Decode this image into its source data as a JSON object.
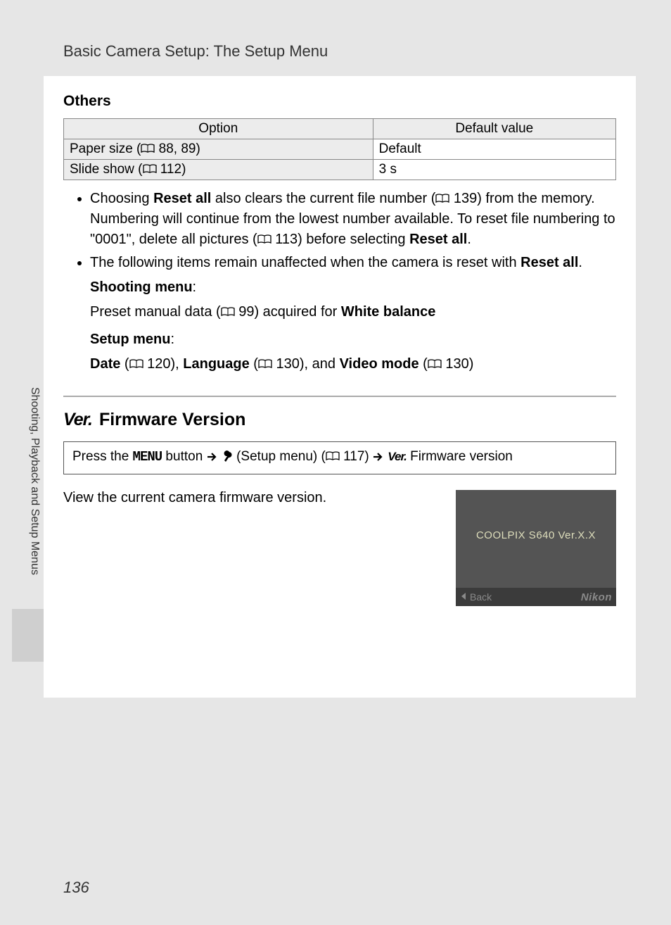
{
  "header": {
    "title": "Basic Camera Setup: The Setup Menu"
  },
  "others": {
    "heading": "Others",
    "columns": {
      "option": "Option",
      "default": "Default value"
    },
    "rows": [
      {
        "opt_prefix": "Paper size (",
        "opt_ref": " 88, 89)",
        "val": "Default"
      },
      {
        "opt_prefix": "Slide show (",
        "opt_ref": " 112)",
        "val": "3 s"
      }
    ]
  },
  "bullets": {
    "b1_a": "Choosing ",
    "b1_reset": "Reset all",
    "b1_b": " also clears the current file number (",
    "b1_ref1": " 139) from the memory. Numbering will continue from the lowest number available. To reset file numbering to \"0001\", delete all pictures (",
    "b1_ref2": " 113) before selecting ",
    "b1_end": ".",
    "b2_a": "The following items remain unaffected when the camera is reset with ",
    "b2_end": ".",
    "shooting_label": "Shooting menu",
    "shooting_line_a": "Preset manual data (",
    "shooting_ref": " 99) acquired for ",
    "wb": "White balance",
    "setup_label": "Setup menu",
    "date": "Date",
    "date_ref": " 120), ",
    "language": "Language",
    "lang_ref": " 130), and ",
    "video": "Video mode",
    "video_ref": " 130)",
    "open_paren": " ("
  },
  "firmware": {
    "ver_glyph": "Ver.",
    "title": "Firmware Version",
    "nav_a": "Press the ",
    "nav_menu": "MENU",
    "nav_b": " button ",
    "nav_c": " (Setup menu) (",
    "nav_ref": " 117) ",
    "nav_d": " Firmware version",
    "desc": "View the current camera firmware version."
  },
  "lcd": {
    "title": "COOLPIX S640 Ver.X.X",
    "back": "Back",
    "brand": "Nikon"
  },
  "side": {
    "label": "Shooting, Playback and Setup Menus"
  },
  "page": "136"
}
